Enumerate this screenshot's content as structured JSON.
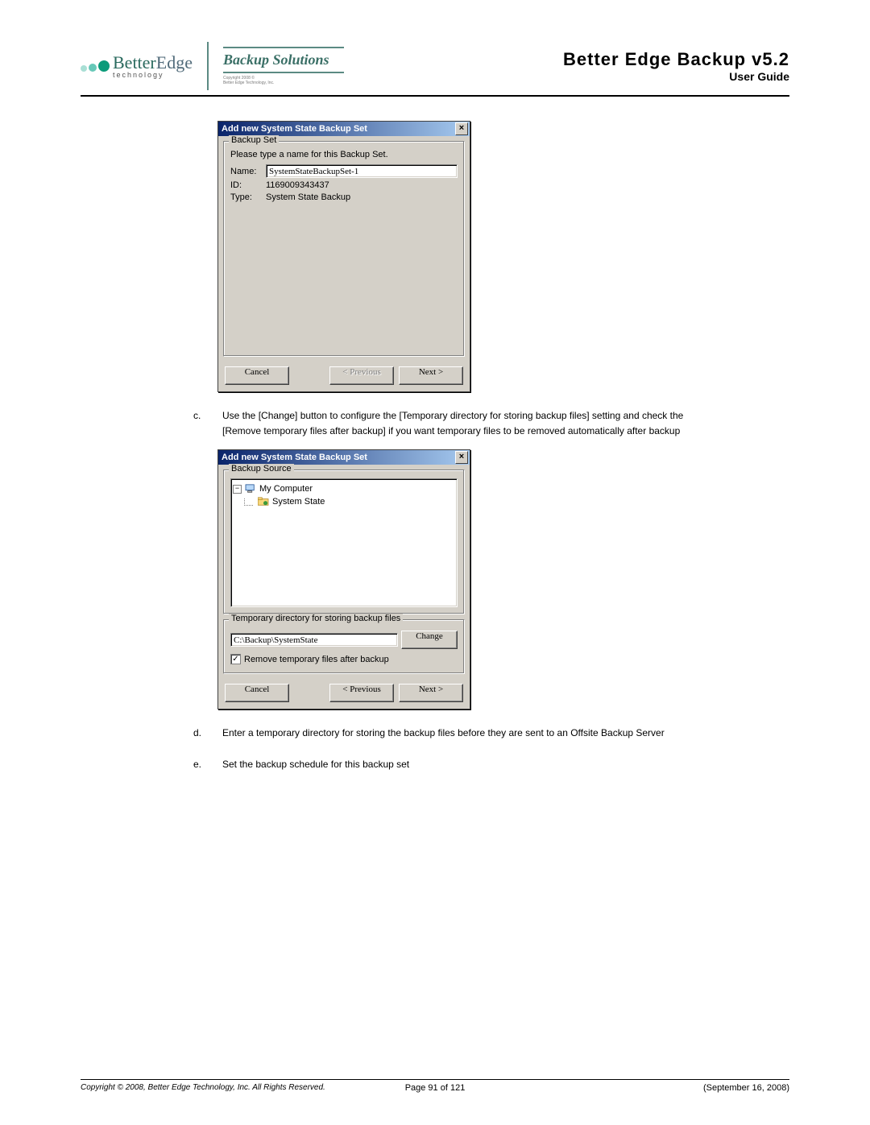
{
  "header": {
    "logo": {
      "company_better": "Better",
      "company_edge": "Edge",
      "tech_line": "technology",
      "solutions_label": "Backup Solutions",
      "mini_copy_line1": "Copyright 2008 ©",
      "mini_copy_line2": "Better Edge Technology, Inc."
    },
    "title_main": "Better Edge Backup v5.2",
    "title_sub": "User Guide"
  },
  "dialog1": {
    "title": "Add new  System State Backup Set",
    "fieldset": "Backup Set",
    "prompt": "Please type a name for this Backup Set.",
    "name_label": "Name:",
    "name_value": "SystemStateBackupSet-1",
    "id_label": "ID:",
    "id_value": "1169009343437",
    "type_label": "Type:",
    "type_value": "System State Backup",
    "cancel": "Cancel",
    "prev": "< Previous",
    "next": "Next >"
  },
  "step_c": {
    "marker": "c.",
    "text": "Use the [Change] button to configure the [Temporary directory for storing backup files] setting and check the [Remove temporary files after backup] if you want temporary files to be removed automatically after backup"
  },
  "dialog2": {
    "title": "Add new  System State Backup Set",
    "fieldset_source": "Backup Source",
    "tree_root": "My Computer",
    "tree_child": "System State",
    "fieldset_temp": "Temporary directory for storing backup files",
    "temp_path": "C:\\Backup\\SystemState",
    "change": "Change",
    "remove_label": "Remove temporary files after backup",
    "cancel": "Cancel",
    "prev": "< Previous",
    "next": "Next >"
  },
  "step_d": {
    "marker": "d.",
    "text": "Enter a temporary directory for storing the backup files before they are sent to an Offsite Backup Server"
  },
  "step_e": {
    "marker": "e.",
    "text": "Set the backup schedule for this backup set"
  },
  "footer": {
    "copyright": "Copyright © 2008, Better Edge Technology, Inc.   All Rights Reserved.",
    "page": "Page 91 of 121",
    "date": "(September 16, 2008)"
  }
}
